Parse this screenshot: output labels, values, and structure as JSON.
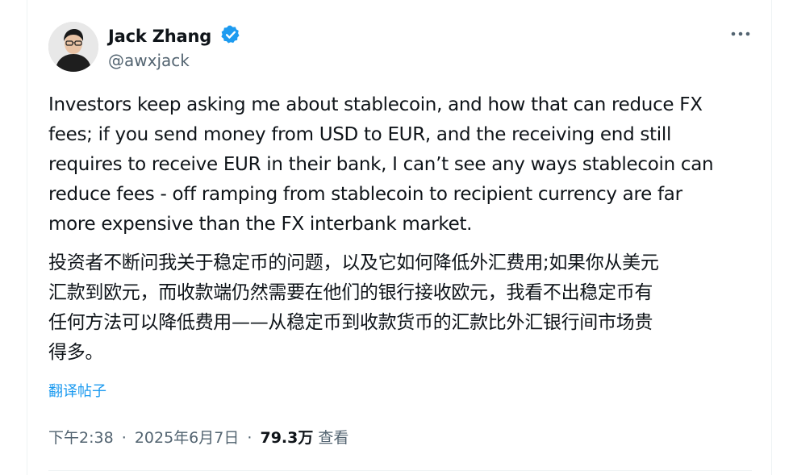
{
  "author": {
    "name": "Jack Zhang",
    "handle": "@awxjack",
    "verified": true
  },
  "post": {
    "text_en_lines": [
      "Investors keep asking me about stablecoin, and how that can reduce FX",
      "fees; if you send money from USD to EUR, and the receiving end still",
      "requires to receive EUR in their bank, I can’t see any ways stablecoin can",
      "reduce fees - off ramping from stablecoin to recipient currency are far",
      "more expensive than the FX interbank market."
    ],
    "text_zh_lines": [
      "投资者不断问我关于稳定币的问题，以及它如何降低外汇费用;如果你从美元",
      "汇款到欧元，而收款端仍然需要在他们的银行接收欧元，我看不出稳定币有",
      "任何方法可以降低费用——从稳定币到收款货币的汇款比外汇银行间市场贵",
      "得多。"
    ],
    "translate_label": "翻译帖子"
  },
  "meta": {
    "time": "下午2:38",
    "date": "2025年6月7日",
    "separator": "·",
    "views_count": "79.3万",
    "views_label": "查看"
  },
  "colors": {
    "accent": "#1d9bf0",
    "secondary_text": "#536471",
    "primary_text": "#0f1419"
  }
}
